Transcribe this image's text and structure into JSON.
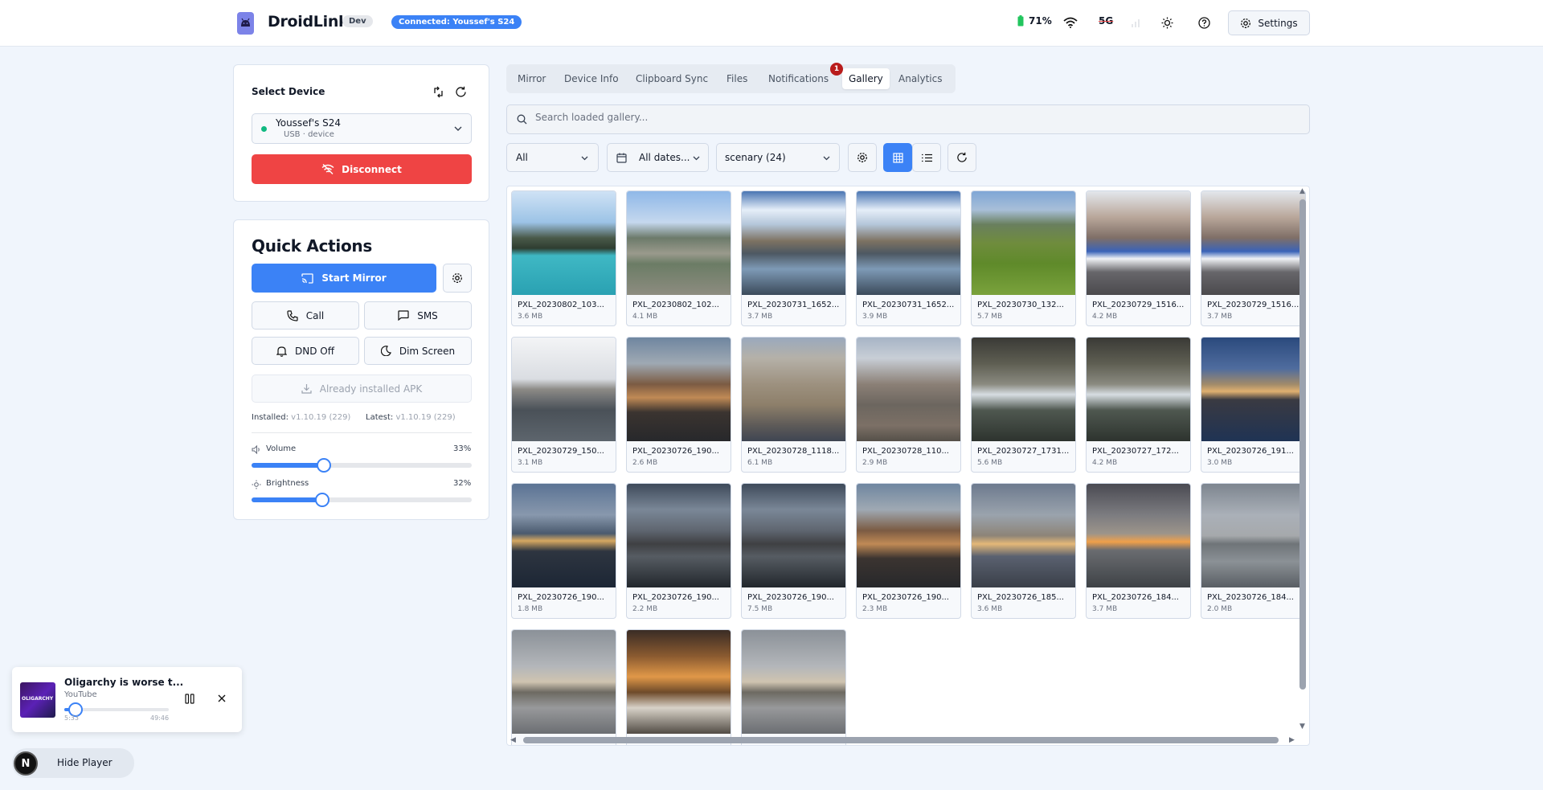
{
  "header": {
    "app_title": "DroidLink",
    "dev_badge": "Dev",
    "connection_badge": "Connected: Youssef's S24",
    "battery": "71%",
    "network": "5G",
    "settings_label": "Settings",
    "battery_color": "#22c55e"
  },
  "device_card": {
    "select_label": "Select Device",
    "device_name": "Youssef's S24",
    "device_sub": "USB · device",
    "disconnect_label": "Disconnect"
  },
  "quick_actions": {
    "title": "Quick Actions",
    "start_mirror": "Start Mirror",
    "call": "Call",
    "sms": "SMS",
    "dnd": "DND Off",
    "dim_screen": "Dim Screen",
    "apk": "Already installed APK",
    "installed_label": "Installed:",
    "installed_version": "v1.10.19 (229)",
    "latest_label": "Latest:",
    "latest_version": "v1.10.19 (229)",
    "volume_label": "Volume",
    "volume_value": "33%",
    "volume_fraction": 0.33,
    "brightness_label": "Brightness",
    "brightness_value": "32%",
    "brightness_fraction": 0.32
  },
  "tabs": [
    {
      "label": "Mirror"
    },
    {
      "label": "Device Info"
    },
    {
      "label": "Clipboard Sync"
    },
    {
      "label": "Files"
    },
    {
      "label": "Notifications"
    },
    {
      "label": "Gallery"
    },
    {
      "label": "Analytics"
    }
  ],
  "notifications_badge": "1",
  "search": {
    "placeholder": "Search loaded gallery..."
  },
  "filters": {
    "type": "All",
    "dates": "All dates...",
    "album": "scenary (24)"
  },
  "gallery": [
    {
      "name": "PXL_20230802_103...",
      "size": "3.6 MB",
      "scene": "lake"
    },
    {
      "name": "PXL_20230802_102...",
      "size": "4.1 MB",
      "scene": "person"
    },
    {
      "name": "PXL_20230731_1652...",
      "size": "3.7 MB",
      "scene": "canal-sun"
    },
    {
      "name": "PXL_20230731_1652...",
      "size": "3.9 MB",
      "scene": "canal-sun"
    },
    {
      "name": "PXL_20230730_132...",
      "size": "5.7 MB",
      "scene": "meadow"
    },
    {
      "name": "PXL_20230729_1516...",
      "size": "4.2 MB",
      "scene": "tram"
    },
    {
      "name": "PXL_20230729_1516...",
      "size": "3.7 MB",
      "scene": "tram"
    },
    {
      "name": "PXL_20230729_150...",
      "size": "3.1 MB",
      "scene": "river"
    },
    {
      "name": "PXL_20230726_190...",
      "size": "2.6 MB",
      "scene": "venice-dusk"
    },
    {
      "name": "PXL_20230728_1118...",
      "size": "6.1 MB",
      "scene": "gothic"
    },
    {
      "name": "PXL_20230728_110...",
      "size": "2.9 MB",
      "scene": "tower"
    },
    {
      "name": "PXL_20230727_1731...",
      "size": "5.6 MB",
      "scene": "gorge"
    },
    {
      "name": "PXL_20230727_172...",
      "size": "4.2 MB",
      "scene": "gorge"
    },
    {
      "name": "PXL_20230726_191...",
      "size": "3.0 MB",
      "scene": "bridge"
    },
    {
      "name": "PXL_20230726_190...",
      "size": "1.8 MB",
      "scene": "bridge-cloud"
    },
    {
      "name": "PXL_20230726_190...",
      "size": "2.2 MB",
      "scene": "canal-cloud"
    },
    {
      "name": "PXL_20230726_190...",
      "size": "7.5 MB",
      "scene": "canal-cloud"
    },
    {
      "name": "PXL_20230726_190...",
      "size": "2.3 MB",
      "scene": "venice-dusk"
    },
    {
      "name": "PXL_20230726_185...",
      "size": "3.6 MB",
      "scene": "boat-view"
    },
    {
      "name": "PXL_20230726_184...",
      "size": "3.7 MB",
      "scene": "sea-sunset"
    },
    {
      "name": "PXL_20230726_184...",
      "size": "2.0 MB",
      "scene": "sea-grey"
    },
    {
      "name": "",
      "size": "",
      "scene": "ship-grey"
    },
    {
      "name": "",
      "size": "",
      "scene": "sunset-boat"
    },
    {
      "name": "",
      "size": "",
      "scene": "ship-grey"
    }
  ],
  "player": {
    "title": "Oligarchy is worse t...",
    "source": "YouTube",
    "elapsed": "5:33",
    "duration": "49:46",
    "progress_fraction": 0.11,
    "thumb_text": "OLIGARCHY"
  },
  "hide_player": {
    "avatar": "N",
    "label": "Hide Player"
  }
}
